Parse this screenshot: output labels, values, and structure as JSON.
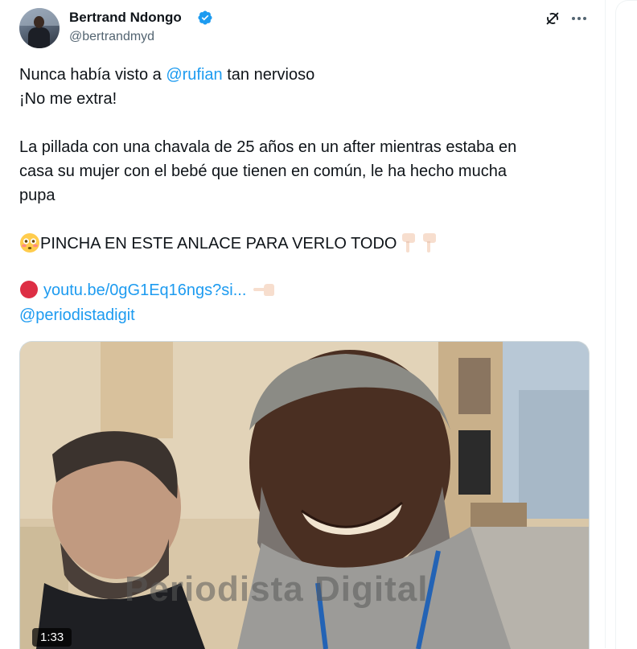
{
  "author": {
    "name": "Bertrand Ndongo",
    "handle": "@bertrandmyd"
  },
  "tweet": {
    "line1_prefix": "Nunca había visto a ",
    "line1_mention": "@rufian",
    "line1_suffix": " tan nervioso",
    "line2": "¡No me extra!",
    "para2_line1": "La pillada con una chavala de 25 años en un after mientras estaba en",
    "para2_line2": "casa su mujer con el bebé que tienen en común, le ha hecho mucha",
    "para2_line3": "pupa",
    "cta": "PINCHA EN ESTE ANLACE PARA VERLO TODO",
    "link_text": "youtu.be/0gG1Eq16ngs?si...",
    "mention2": "@periodistadigit"
  },
  "media": {
    "watermark": "Periodista Digital",
    "duration": "1:33"
  },
  "icons": {
    "verified": "verified-badge-icon",
    "grok": "grok-icon",
    "more": "more-icon",
    "flushed": "flushed-face-emoji",
    "point_down": "point-down-emoji",
    "red_circle": "red-circle-emoji",
    "point_left": "point-left-emoji"
  },
  "colors": {
    "accent": "#1d9bf0",
    "text": "#0f1419",
    "muted": "#536471"
  }
}
